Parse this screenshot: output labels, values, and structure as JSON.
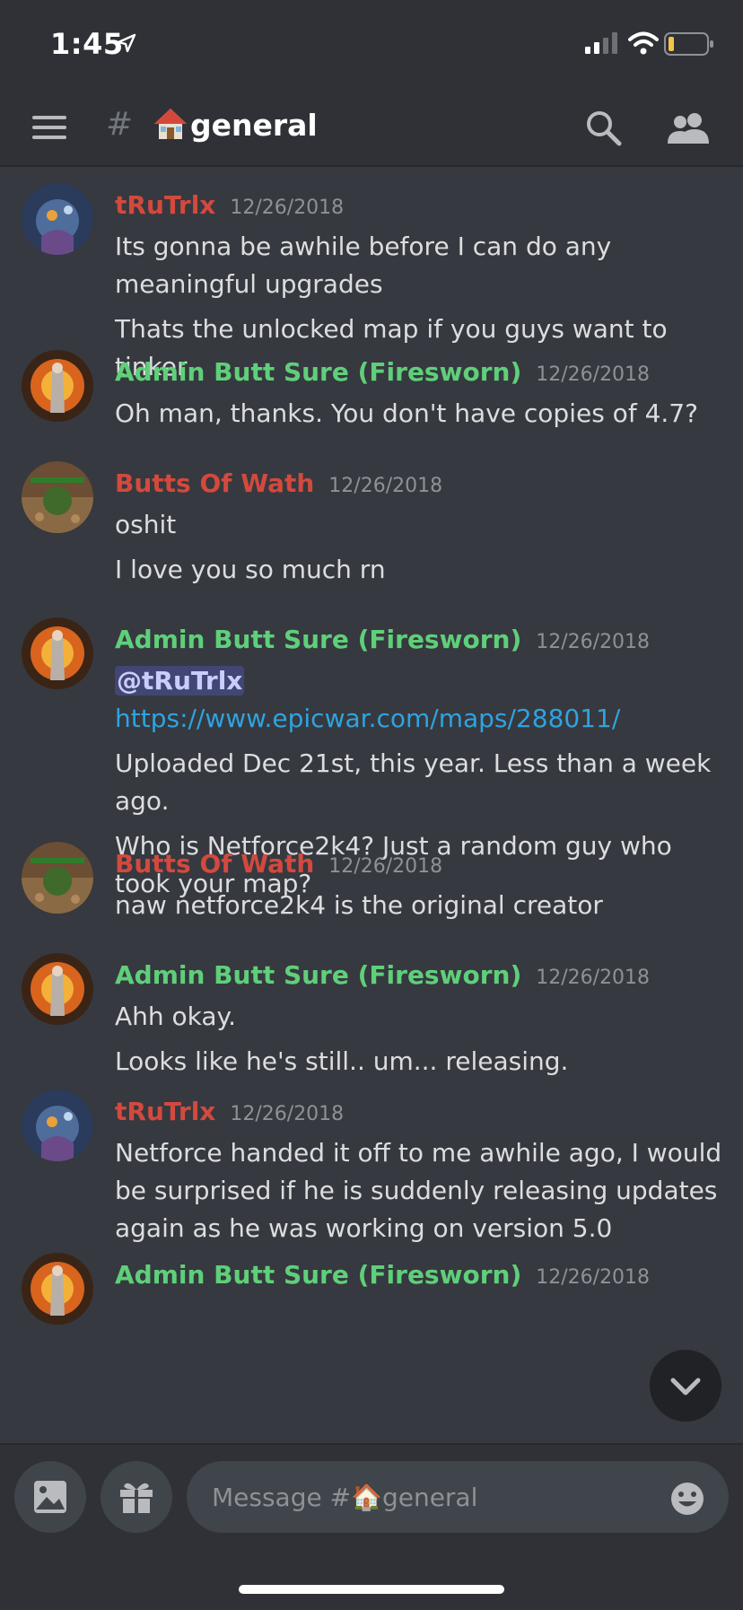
{
  "status_bar": {
    "time": "1:45"
  },
  "header": {
    "hash": "#",
    "channel_name": "general"
  },
  "messages": [
    {
      "author": "tRuTrlx",
      "timestamp": "12/26/2018",
      "lines": [
        "Its gonna be awhile before I can do any meaningful upgrades",
        "Thats the unlocked map if you guys want to tinker"
      ]
    },
    {
      "author": "Admin Butt Sure (Firesworn)",
      "timestamp": "12/26/2018",
      "lines": [
        "Oh man, thanks. You don't have copies of 4.7?"
      ]
    },
    {
      "author": "Butts Of Wath",
      "timestamp": "12/26/2018",
      "lines": [
        "oshit",
        "I love you so much rn"
      ]
    },
    {
      "author": "Admin Butt Sure (Firesworn)",
      "timestamp": "12/26/2018",
      "mention": "@tRuTrlx",
      "link": "https://www.epicwar.com/maps/288011/",
      "lines": [
        "Uploaded Dec 21st, this year. Less than a week ago.",
        "Who is Netforce2k4? Just a random guy who took your map?"
      ]
    },
    {
      "author": "Butts Of Wath",
      "timestamp": "12/26/2018",
      "lines": [
        "naw netforce2k4 is the original creator"
      ]
    },
    {
      "author": "Admin Butt Sure (Firesworn)",
      "timestamp": "12/26/2018",
      "lines": [
        "Ahh okay.",
        "Looks like he's still.. um... releasing."
      ]
    },
    {
      "author": "tRuTrlx",
      "timestamp": "12/26/2018",
      "lines": [
        "Netforce handed it off to me awhile ago, I would be surprised if he is suddenly releasing updates again as he was working on version 5.0"
      ]
    },
    {
      "author": "Admin Butt Sure (Firesworn)",
      "timestamp": "12/26/2018",
      "lines": []
    }
  ],
  "composer": {
    "placeholder": "Message #🏠general"
  },
  "colors": {
    "author_red": "#d3493e",
    "author_green": "#5fcf7a",
    "background": "#36393f",
    "link": "#2fa3e0"
  }
}
